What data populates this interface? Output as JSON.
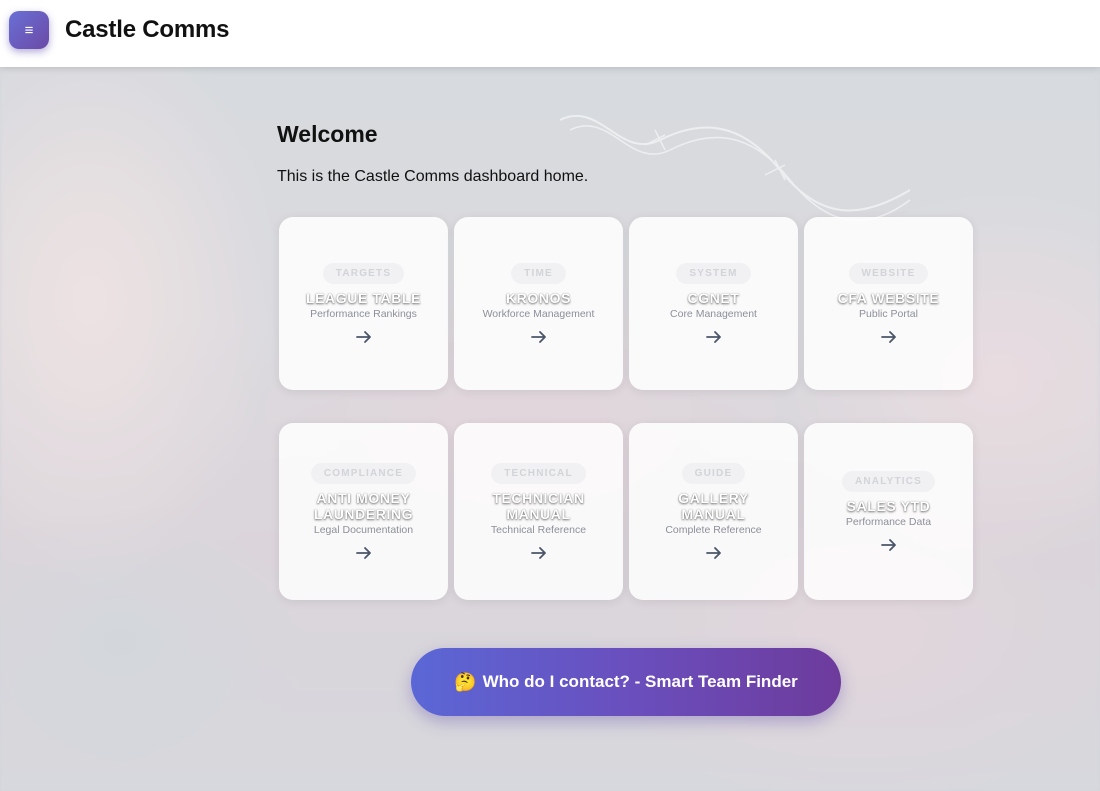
{
  "header": {
    "menu_icon": "≡",
    "title": "Castle Comms"
  },
  "welcome": {
    "title": "Welcome",
    "text": "This is the Castle Comms dashboard home."
  },
  "cards": [
    {
      "tag": "TARGETS",
      "name": "LEAGUE TABLE",
      "sub": "Performance Rankings",
      "icon": "arrow-right-icon"
    },
    {
      "tag": "TIME",
      "name": "KRONOS",
      "sub": "Workforce Management",
      "icon": "arrow-right-icon"
    },
    {
      "tag": "SYSTEM",
      "name": "CGNET",
      "sub": "Core Management",
      "icon": "arrow-right-icon"
    },
    {
      "tag": "WEBSITE",
      "name": "CFA WEBSITE",
      "sub": "Public Portal",
      "icon": "arrow-right-icon"
    },
    {
      "tag": "COMPLIANCE",
      "name": "ANTI MONEY LAUNDERING",
      "sub": "Legal Documentation",
      "icon": "arrow-right-icon"
    },
    {
      "tag": "TECHNICAL",
      "name": "TECHNICIAN MANUAL",
      "sub": "Technical Reference",
      "icon": "arrow-right-icon"
    },
    {
      "tag": "GUIDE",
      "name": "GALLERY MANUAL",
      "sub": "Complete Reference",
      "icon": "arrow-right-icon"
    },
    {
      "tag": "ANALYTICS",
      "name": "SALES YTD",
      "sub": "Performance Data",
      "icon": "arrow-right-icon"
    }
  ],
  "contact_button": {
    "emoji": "🤔",
    "label": "Who do I contact? - Smart Team Finder"
  },
  "colors": {
    "accent_start": "#5b67d6",
    "accent_end": "#6d3b9c"
  }
}
